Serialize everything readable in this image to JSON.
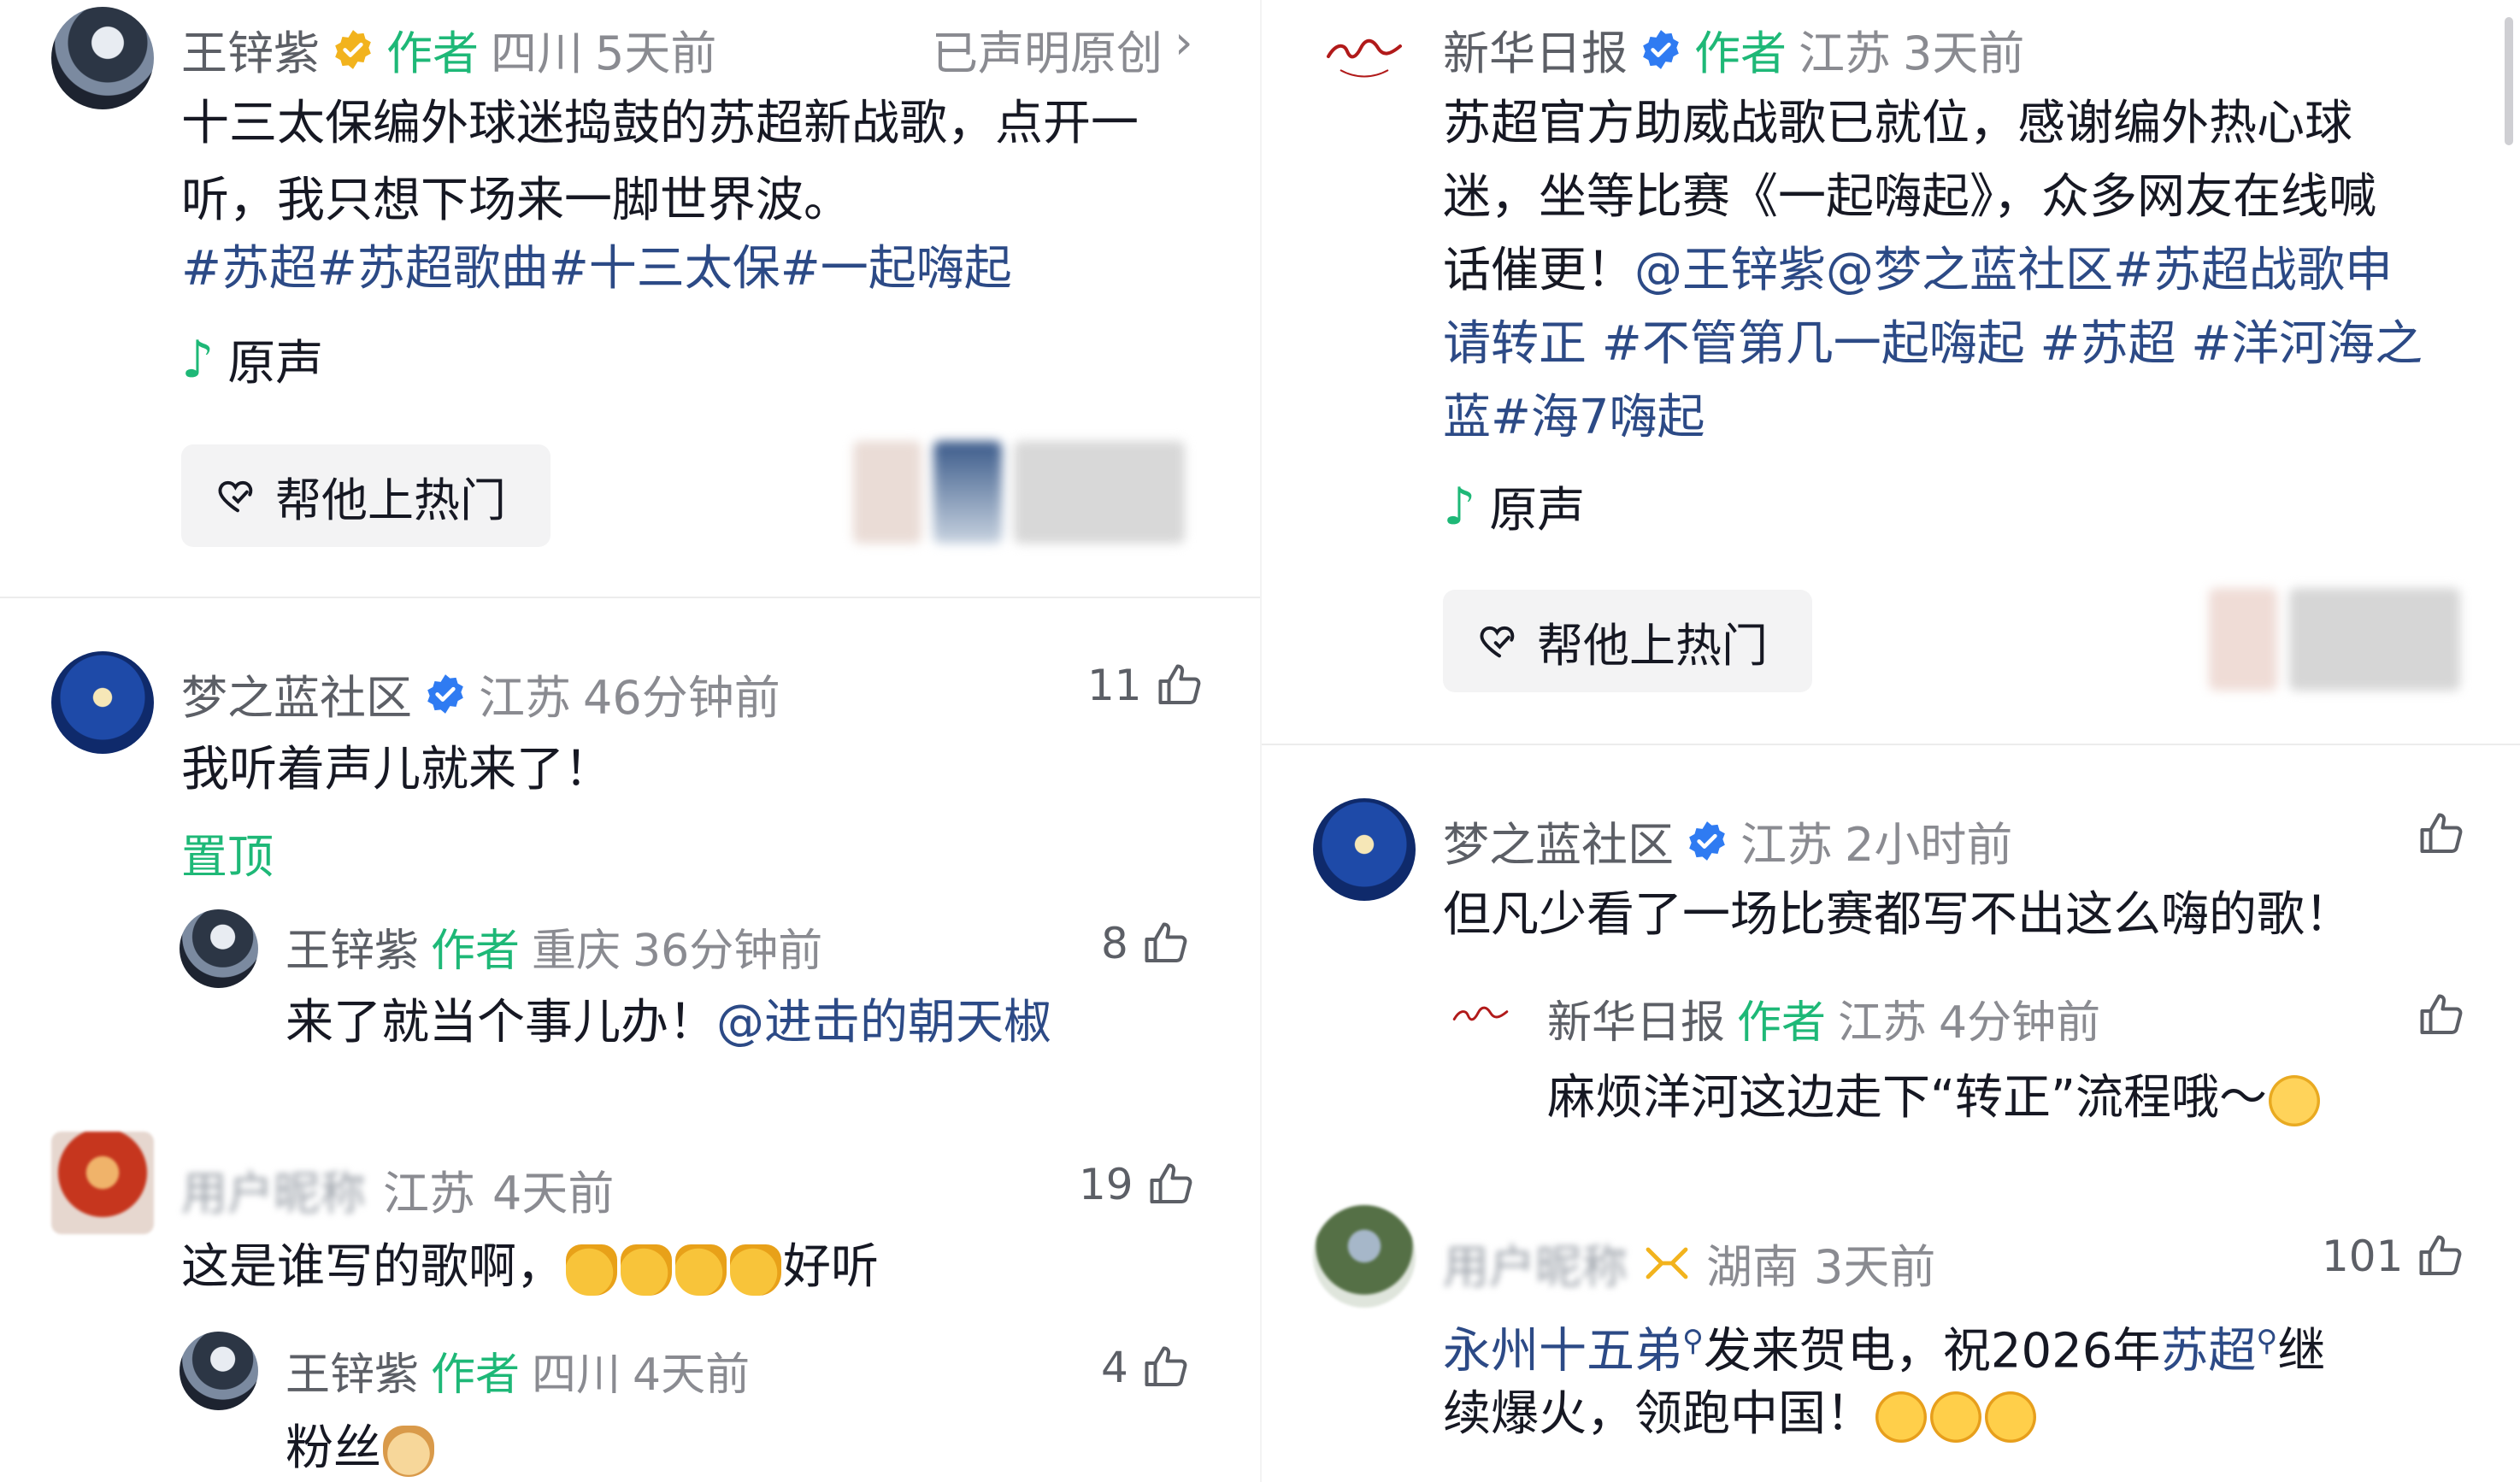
{
  "left": {
    "post": {
      "author": "王锌紫",
      "author_tag": "作者",
      "location": "四川",
      "time": "5天前",
      "original_label": "已声明原创",
      "chevron": "›",
      "text": "十三太保编外球迷捣鼓的苏超新战歌，点开一听，我只想下场来一脚世界波。",
      "hashtags": "#苏超#苏超歌曲#十三太保#一起嗨起",
      "music": "原声",
      "hot_button": "帮他上热门"
    },
    "comments": [
      {
        "name": "梦之蓝社区",
        "location": "江苏",
        "time": "46分钟前",
        "likes": "11",
        "text": "我听着声儿就来了！",
        "pinned": "置顶",
        "reply": {
          "name": "王锌紫",
          "author_tag": "作者",
          "location": "重庆",
          "time": "36分钟前",
          "likes": "8",
          "text": "来了就当个事儿办！",
          "mention": "@进击的朝天椒"
        }
      },
      {
        "name": "用户昵称",
        "location": "江苏",
        "time": "4天前",
        "likes": "19",
        "text_before": "这是谁写的歌啊，",
        "text_after": "好听",
        "reply": {
          "name": "王锌紫",
          "author_tag": "作者",
          "location": "四川",
          "time": "4天前",
          "likes": "4",
          "text": "粉丝"
        }
      }
    ]
  },
  "right": {
    "post": {
      "author": "新华日报",
      "author_tag": "作者",
      "location": "江苏",
      "time": "3天前",
      "text_lines": [
        "苏超官方助威战歌已就位，感谢编外热心球",
        "迷，坐等比赛《一起嗨起》，众多网友在线喊"
      ],
      "line3_text": "话催更！",
      "line3_tags": "@王锌紫@梦之蓝社区#苏超战歌申",
      "line4_tags": "请转正 #不管第几一起嗨起 #苏超 #洋河海之",
      "line5_tags": "蓝#海7嗨起",
      "music": "原声",
      "hot_button": "帮他上热门"
    },
    "comments": [
      {
        "name": "梦之蓝社区",
        "location": "江苏",
        "time": "2小时前",
        "text": "但凡少看了一场比赛都写不出这么嗨的歌！",
        "reply": {
          "name": "新华日报",
          "author_tag": "作者",
          "location": "江苏",
          "time": "4分钟前",
          "text": "麻烦洋河这边走下“转正”流程哦～"
        }
      },
      {
        "name": "用户昵称",
        "location": "湖南",
        "time": "3天前",
        "likes": "101",
        "text_l1_a": "永州十五弟",
        "text_l1_b": "发来贺电，祝2026年",
        "text_l1_c": "苏超",
        "text_l1_d": "继",
        "text_l2": "续爆火，领跑中国！"
      }
    ]
  },
  "colors": {
    "author_green": "#1eb877",
    "link_blue": "#2c4a86",
    "verified_blue": "#2f7bf2",
    "badge_gold": "#f2b31d"
  },
  "icons": [
    "gold-verified-icon",
    "blue-verified-icon",
    "music-note-icon",
    "heart-icon",
    "thumb-up-icon",
    "chevron-right-icon",
    "search-icon"
  ]
}
